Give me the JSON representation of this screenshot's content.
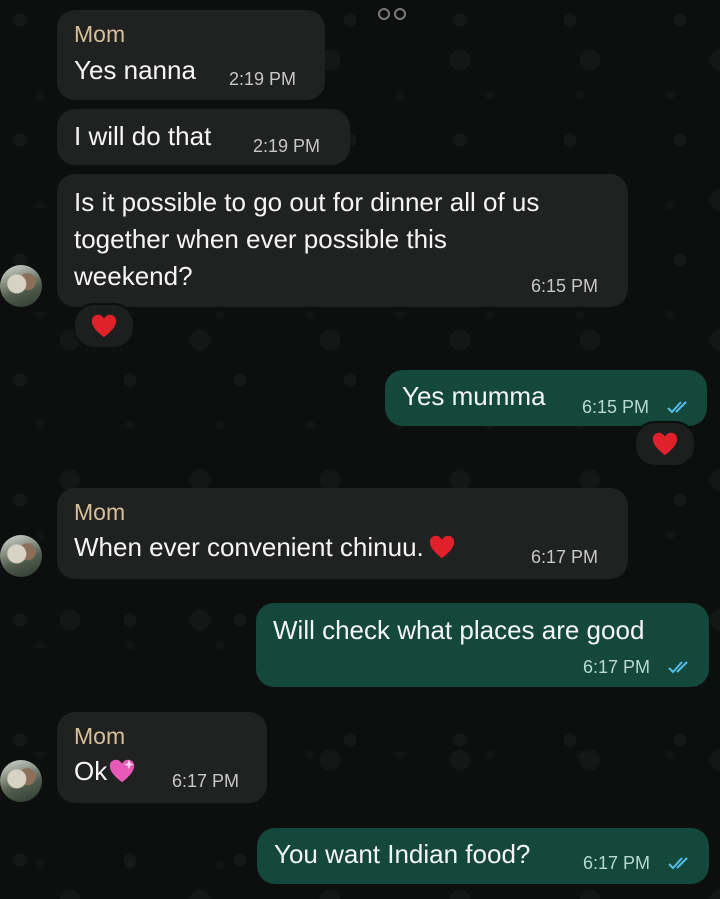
{
  "messages": [
    {
      "sender": "Mom",
      "text": "Yes nanna",
      "time": "2:19 PM"
    },
    {
      "text": "I will do that",
      "time": "2:19 PM"
    },
    {
      "text_lines": [
        "Is it possible to go out for dinner all of us",
        "together when ever possible this",
        "weekend?"
      ],
      "time": "6:15 PM",
      "reaction": "red-heart"
    },
    {
      "text": "Yes mumma",
      "time": "6:15 PM",
      "reaction": "red-heart"
    },
    {
      "sender": "Mom",
      "text": "When ever convenient chinuu.",
      "time": "6:17 PM"
    },
    {
      "text": "Will check what places are good",
      "time": "6:17 PM"
    },
    {
      "sender": "Mom",
      "text": "Ok",
      "time": "6:17 PM"
    },
    {
      "text": "You want Indian food?",
      "time": "6:17 PM"
    }
  ],
  "colors": {
    "incoming_bubble": "#202121",
    "outgoing_bubble": "#13483a",
    "sender_name": "#d9bf98",
    "read_tick": "#53bdeb",
    "heart": "#e0202a"
  }
}
